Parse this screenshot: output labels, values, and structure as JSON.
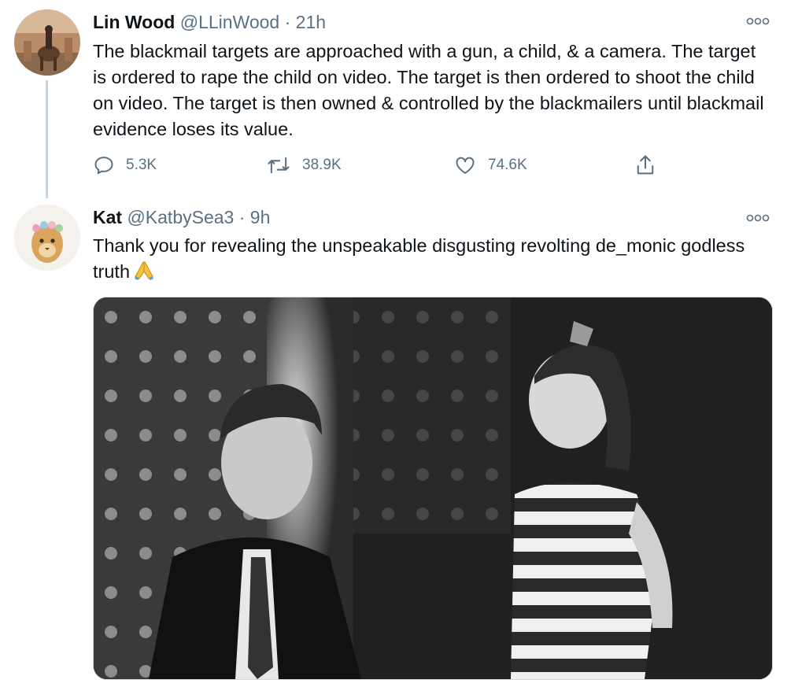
{
  "tweets": [
    {
      "name": "Lin Wood",
      "handle": "@LLinWood",
      "separator": "·",
      "time": "21h",
      "text": "The blackmail targets are approached with a gun, a child, & a camera. The target is ordered to rape the child on video. The target is then ordered to shoot the child on video. The target is then owned & controlled by the blackmailers until blackmail evidence loses its value.",
      "actions": {
        "reply_count": "5.3K",
        "retweet_count": "38.9K",
        "like_count": "74.6K"
      },
      "icons": [
        "more-icon",
        "reply-icon",
        "retweet-icon",
        "like-icon",
        "share-icon"
      ]
    },
    {
      "name": "Kat",
      "handle": "@KatbySea3",
      "separator": "·",
      "time": "9h",
      "text": "Thank you for revealing the unspeakable disgusting revolting de_monic godless truth",
      "emoji": "folded-hands-icon",
      "media": "black-and-white photo"
    }
  ],
  "colors": {
    "text_primary": "#0f1419",
    "text_secondary": "#5b7083",
    "thread_line": "#c9d3db"
  }
}
